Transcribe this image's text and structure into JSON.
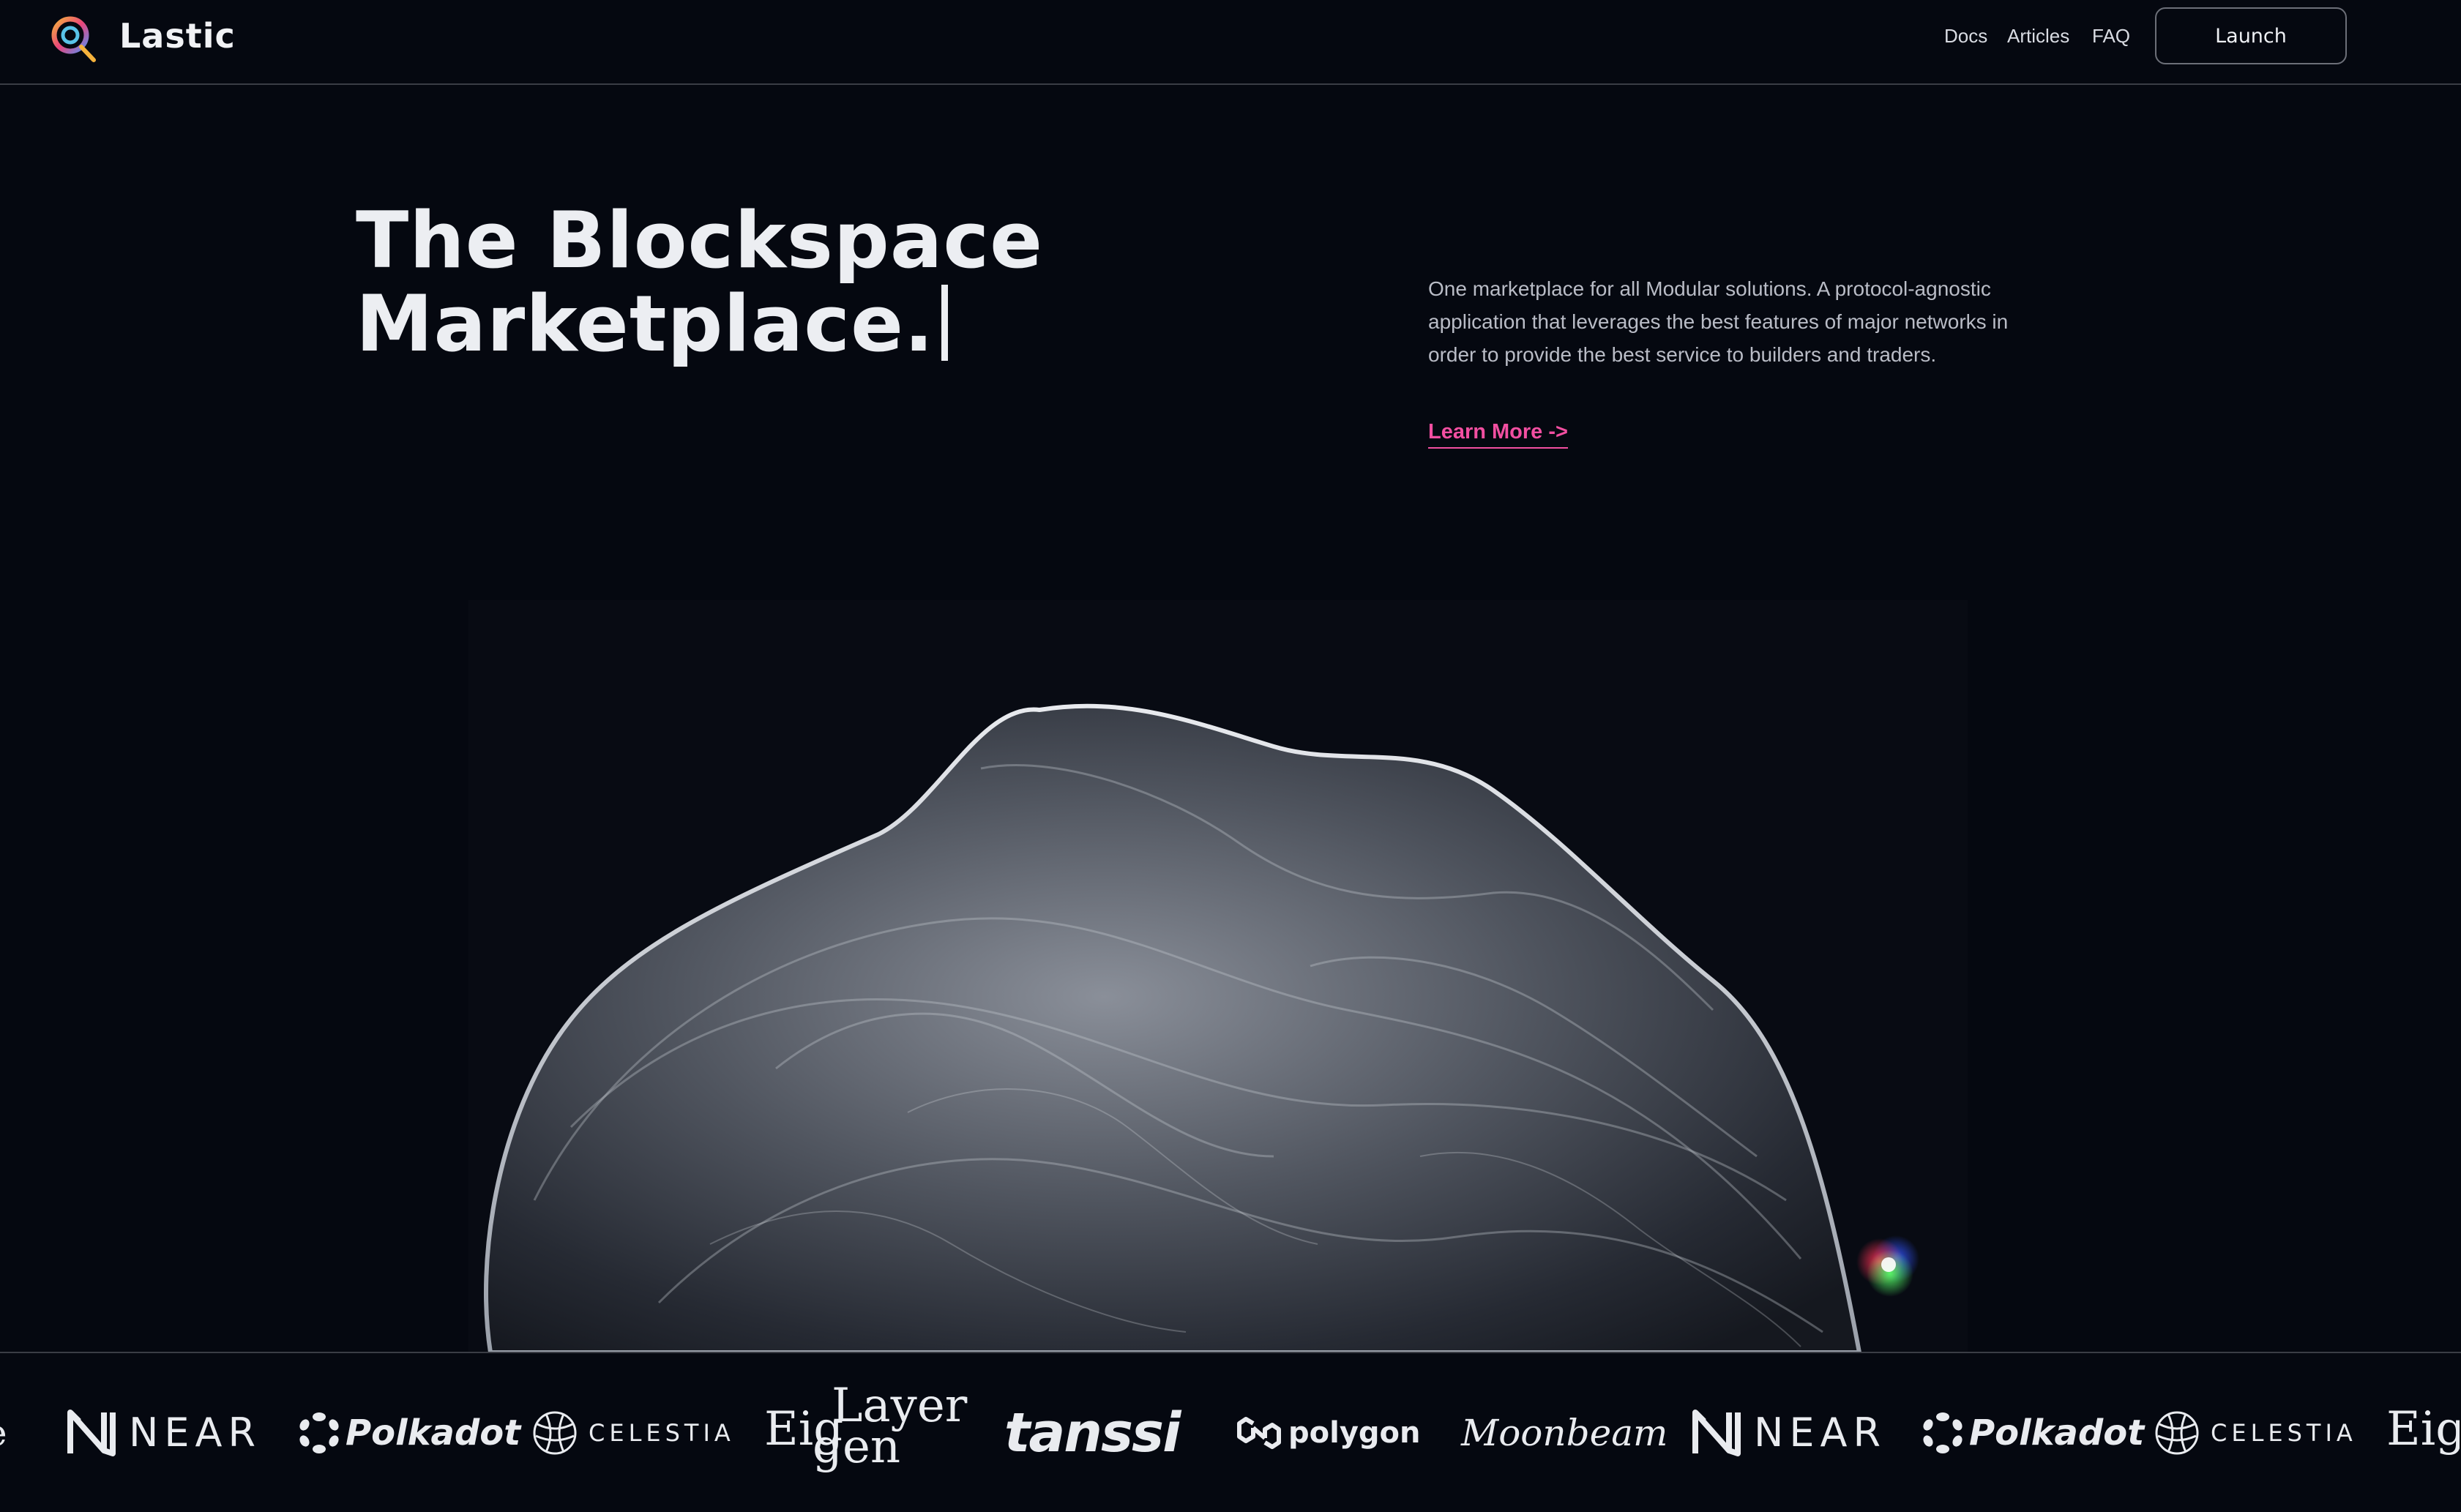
{
  "header": {
    "brand": "Lastic",
    "nav": [
      {
        "label": "Docs"
      },
      {
        "label": "Articles"
      },
      {
        "label": "FAQ"
      }
    ],
    "launch_label": "Launch"
  },
  "hero": {
    "title_line1": "The Blockspace",
    "title_line2": "Marketplace.",
    "description": "One marketplace for all Modular solutions. A protocol-agnostic application that leverages the best features of major networks in order to provide the best service to builders and traders.",
    "learn_more": "Learn More ->"
  },
  "partners": {
    "near": "NEAR",
    "polkadot": "Polkadot",
    "celestia": "CELESTIA",
    "eigen_top": "Layer",
    "eigen_left": "Eig",
    "eigen_bottom": "gen",
    "tanssi": "tanssi",
    "polygon": "polygon",
    "moonbeam": "Moonbeam"
  },
  "colors": {
    "background": "#050810",
    "accent": "#f24fa1",
    "divider": "#3a3d45"
  }
}
